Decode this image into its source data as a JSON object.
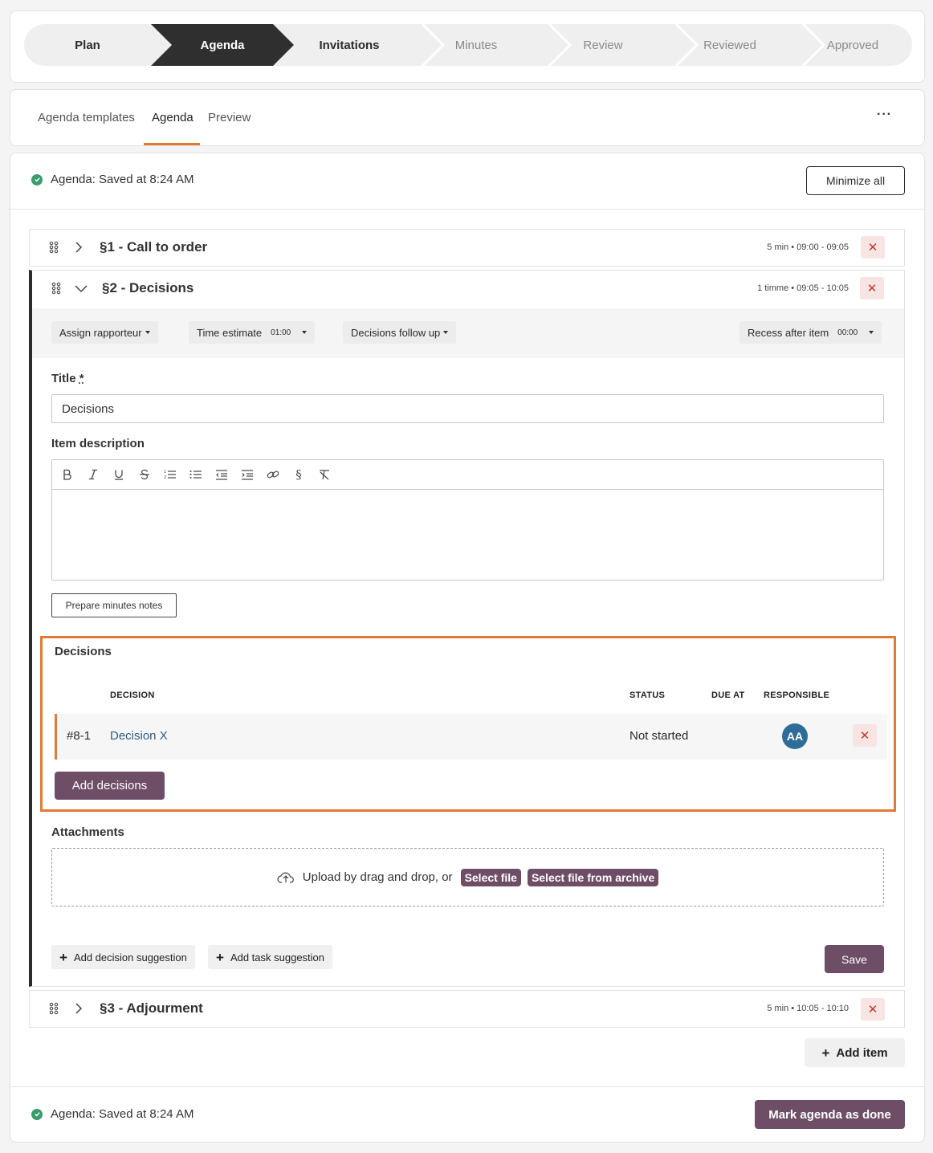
{
  "stepper": {
    "steps": [
      {
        "label": "Plan",
        "state": "done"
      },
      {
        "label": "Agenda",
        "state": "active"
      },
      {
        "label": "Invitations",
        "state": "done"
      },
      {
        "label": "Minutes",
        "state": "pending"
      },
      {
        "label": "Review",
        "state": "pending"
      },
      {
        "label": "Reviewed",
        "state": "pending"
      },
      {
        "label": "Approved",
        "state": "pending"
      }
    ]
  },
  "tabs": {
    "items": [
      "Agenda templates",
      "Agenda",
      "Preview"
    ],
    "active": "Agenda",
    "more_label": "···"
  },
  "status": {
    "saved_text": "Agenda: Saved at 8:24 AM",
    "minimize_label": "Minimize all"
  },
  "agenda_items": [
    {
      "title": "§1 - Call to order",
      "meta": "5 min • 09:00 - 09:05",
      "expanded": false
    },
    {
      "title": "§2 - Decisions",
      "meta": "1 timme • 09:05 - 10:05",
      "expanded": true
    },
    {
      "title": "§3 - Adjourment",
      "meta": "5 min • 10:05 - 10:10",
      "expanded": false
    }
  ],
  "item_toolbar": {
    "assign_rapporteur": "Assign rapporteur",
    "time_estimate": "Time estimate",
    "time_estimate_value": "01:00",
    "decisions_follow_up": "Decisions follow up",
    "recess_after_item": "Recess after item",
    "recess_value": "00:00"
  },
  "form": {
    "title_label": "Title",
    "required_mark": "*",
    "title_value": "Decisions",
    "description_label": "Item description",
    "prepare_minutes_label": "Prepare minutes notes"
  },
  "decisions": {
    "heading": "Decisions",
    "columns": [
      "DECISION",
      "STATUS",
      "DUE AT",
      "RESPONSIBLE"
    ],
    "rows": [
      {
        "id": "#8-1",
        "title": "Decision X",
        "status": "Not started",
        "due_at": "",
        "responsible_initials": "AA"
      }
    ],
    "add_label": "Add decisions"
  },
  "attachments": {
    "heading": "Attachments",
    "upload_text": "Upload by drag and drop, or",
    "select_file": "Select file",
    "select_archive": "Select file from archive"
  },
  "suggestions": {
    "add_decision": "Add decision suggestion",
    "add_task": "Add task suggestion",
    "save_label": "Save"
  },
  "footer": {
    "add_item_label": "Add item",
    "saved_text": "Agenda: Saved at 8:24 AM",
    "mark_done_label": "Mark agenda as done"
  },
  "colors": {
    "accent": "#e07a35",
    "primary": "#6e4e67",
    "active_step": "#2f2f2f",
    "avatar": "#2f6d99",
    "success": "#3a9b6b",
    "danger": "#c0392b",
    "link": "#2b5c82"
  }
}
